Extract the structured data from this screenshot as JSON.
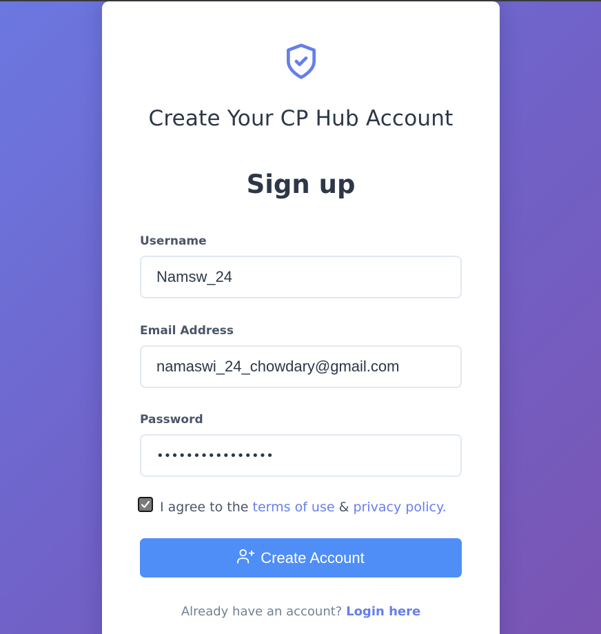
{
  "app": {
    "title": "Create Your CP Hub Account",
    "accent_color": "#667eea",
    "button_color": "#4f8ef7",
    "icon": "shield-check-icon"
  },
  "form": {
    "heading": "Sign up",
    "username": {
      "label": "Username",
      "value": "Namsw_24"
    },
    "email": {
      "label": "Email Address",
      "value": "namaswi_24_chowdary@gmail.com"
    },
    "password": {
      "label": "Password",
      "value": "••••••••••••••••"
    },
    "agree": {
      "checked": true,
      "prefix": "I agree to the",
      "terms_link": "terms of use",
      "and": "&",
      "privacy_link": "privacy policy",
      "suffix": "."
    },
    "submit": {
      "label": "Create Account",
      "icon": "user-plus-icon"
    }
  },
  "footer": {
    "text": "Already have an account?",
    "link": "Login here"
  }
}
